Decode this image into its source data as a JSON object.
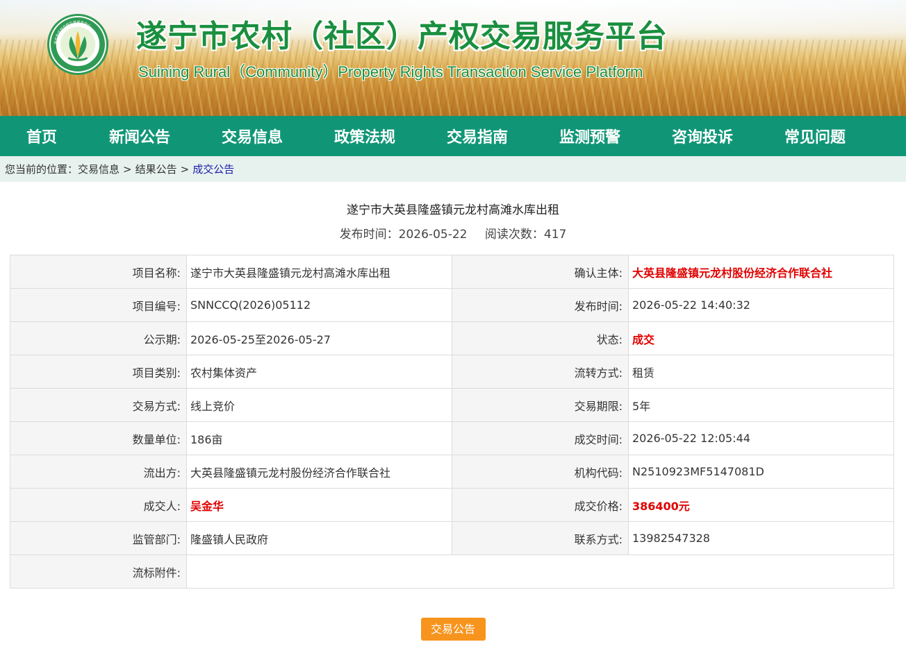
{
  "header": {
    "title_cn": "遂宁市农村（社区）产权交易服务平台",
    "title_en": "Suining Rural（Community）Property Rights Transaction Service Platform",
    "logo_ring_text": "遂宁市农村产权交易服务中心",
    "brand_color": "#1a8f3e"
  },
  "nav": {
    "items": [
      "首页",
      "新闻公告",
      "交易信息",
      "政策法规",
      "交易指南",
      "监测预警",
      "咨询投诉",
      "常见问题"
    ],
    "color": "#109677"
  },
  "breadcrumb": {
    "prefix": "您当前的位置：",
    "items": [
      "交易信息",
      "结果公告"
    ],
    "separator": ">",
    "current": "成交公告"
  },
  "article": {
    "title": "遂宁市大英县隆盛镇元龙村高滩水库出租",
    "publish_label": "发布时间：2026-05-22",
    "views_label": "阅读次数：417"
  },
  "table": {
    "rows": [
      {
        "l1": "项目名称:",
        "v1": "遂宁市大英县隆盛镇元龙村高滩水库出租",
        "l2": "确认主体:",
        "v2": "大英县隆盛镇元龙村股份经济合作联合社"
      },
      {
        "l1": "项目编号:",
        "v1": "SNNCCQ(2026)05112",
        "l2": "发布时间:",
        "v2": "2026-05-22 14:40:32"
      },
      {
        "l1": "公示期:",
        "v1": "2026-05-25至2026-05-27",
        "l2": "状态:",
        "v2": "成交"
      },
      {
        "l1": "项目类别:",
        "v1": "农村集体资产",
        "l2": "流转方式:",
        "v2": "租赁"
      },
      {
        "l1": "交易方式:",
        "v1": "线上竞价",
        "l2": "交易期限:",
        "v2": "5年"
      },
      {
        "l1": "数量单位:",
        "v1": "186亩",
        "l2": "成交时间:",
        "v2": "2026-05-22 12:05:44"
      },
      {
        "l1": "流出方:",
        "v1": "大英县隆盛镇元龙村股份经济合作联合社",
        "l2": "机构代码:",
        "v2": "N2510923MF5147081D"
      },
      {
        "l1": "成交人:",
        "v1": "吴金华",
        "l2": "成交价格:",
        "v2": "386400元"
      },
      {
        "l1": "监管部门:",
        "v1": "隆盛镇人民政府",
        "l2": "联系方式:",
        "v2": "13982547328"
      },
      {
        "l1": "流标附件:",
        "v1": ""
      }
    ],
    "highlight_color": "#e00000"
  },
  "footer_button": {
    "label": "交易公告",
    "color": "#f7941d"
  }
}
